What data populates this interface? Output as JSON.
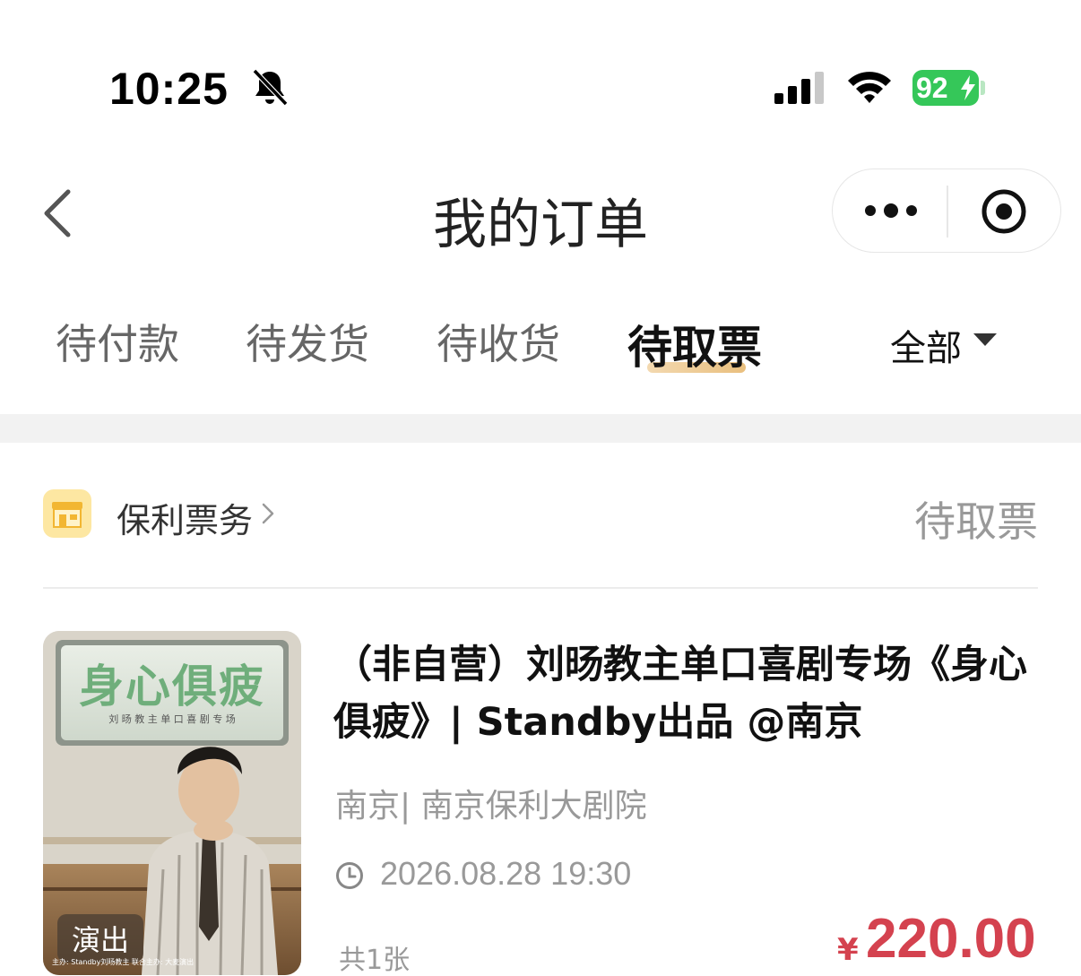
{
  "status_bar": {
    "time": "10:25",
    "battery": "92",
    "icons": [
      "bell-slash-icon",
      "cellular-signal-icon",
      "wifi-icon",
      "battery-charging-icon"
    ]
  },
  "nav": {
    "title": "我的订单",
    "icons": [
      "back-chevron-icon",
      "more-dots-icon",
      "target-circle-icon"
    ]
  },
  "tabs": [
    {
      "label": "待付款",
      "active": false
    },
    {
      "label": "待发货",
      "active": false
    },
    {
      "label": "待收货",
      "active": false
    },
    {
      "label": "待取票",
      "active": true
    }
  ],
  "filter": {
    "label": "全部"
  },
  "order": {
    "shop_name": "保利票务",
    "status": "待取票",
    "product_title": "（非自营）刘旸教主单口喜剧专场《身心俱疲》| Standby出品 @南京",
    "venue": "南京| 南京保利大剧院",
    "datetime": "2026.08.28 19:30",
    "quantity": "共1张",
    "currency": "¥",
    "price": "220.00",
    "poster": {
      "title": "身心俱疲",
      "subtitle": "刘 旸 教 主 单 口 喜 剧 专 场",
      "tag": "演出",
      "credits": "主办: Standby刘旸教主   联合主办: 大麦演出"
    }
  },
  "colors": {
    "accent_price": "#d4424f",
    "battery": "#35c759",
    "tab_underline": "#e9bf7e",
    "shop_icon_bg": "#fde7a2"
  }
}
